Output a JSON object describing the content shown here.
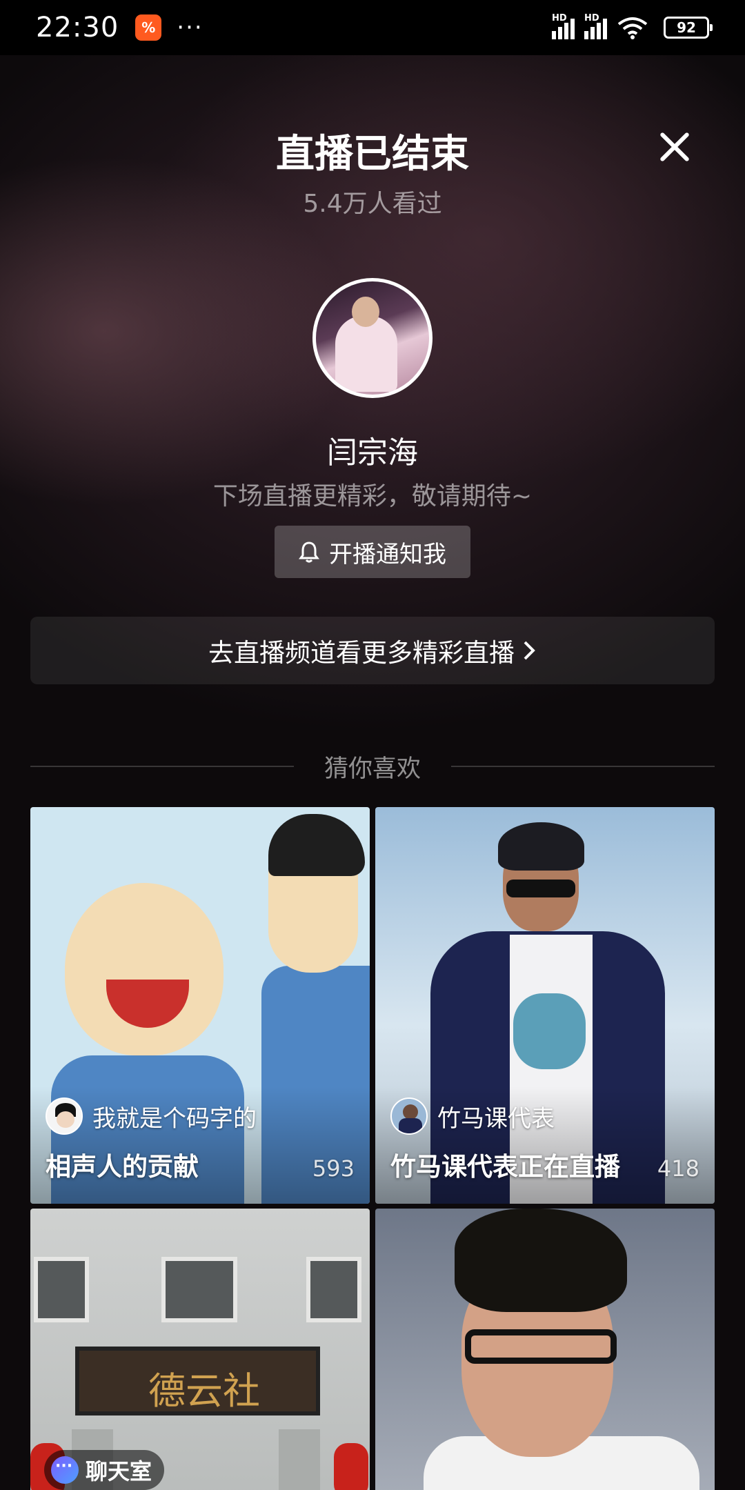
{
  "status_bar": {
    "time": "22:30",
    "app_icon_glyph": "%",
    "more": "···",
    "signal_label": "HD",
    "battery": "92"
  },
  "header": {
    "title": "直播已结束",
    "viewers": "5.4万人看过"
  },
  "streamer": {
    "name": "闫宗海",
    "subtitle": "下场直播更精彩，敬请期待~",
    "notify_label": "开播通知我"
  },
  "channel_link": {
    "label": "去直播频道看更多精彩直播",
    "chevron": "›"
  },
  "recommend": {
    "section_title": "猜你喜欢",
    "cards": [
      {
        "user": "我就是个码字的",
        "title": "相声人的贡献",
        "count": "593"
      },
      {
        "user": "竹马课代表",
        "title": "竹马课代表正在直播",
        "count": "418"
      },
      {
        "tag": "聊天室",
        "sign_text": "德云社"
      },
      {}
    ]
  },
  "colors": {
    "background": "#0d0a0c",
    "button_bg": "rgba(255,255,255,0.22)",
    "muted_text": "rgba(255,255,255,0.55)"
  },
  "icons": [
    "close-icon",
    "bell-icon",
    "chevron-right-icon",
    "chat-room-icon",
    "wifi-icon",
    "signal-icon",
    "battery-icon"
  ]
}
